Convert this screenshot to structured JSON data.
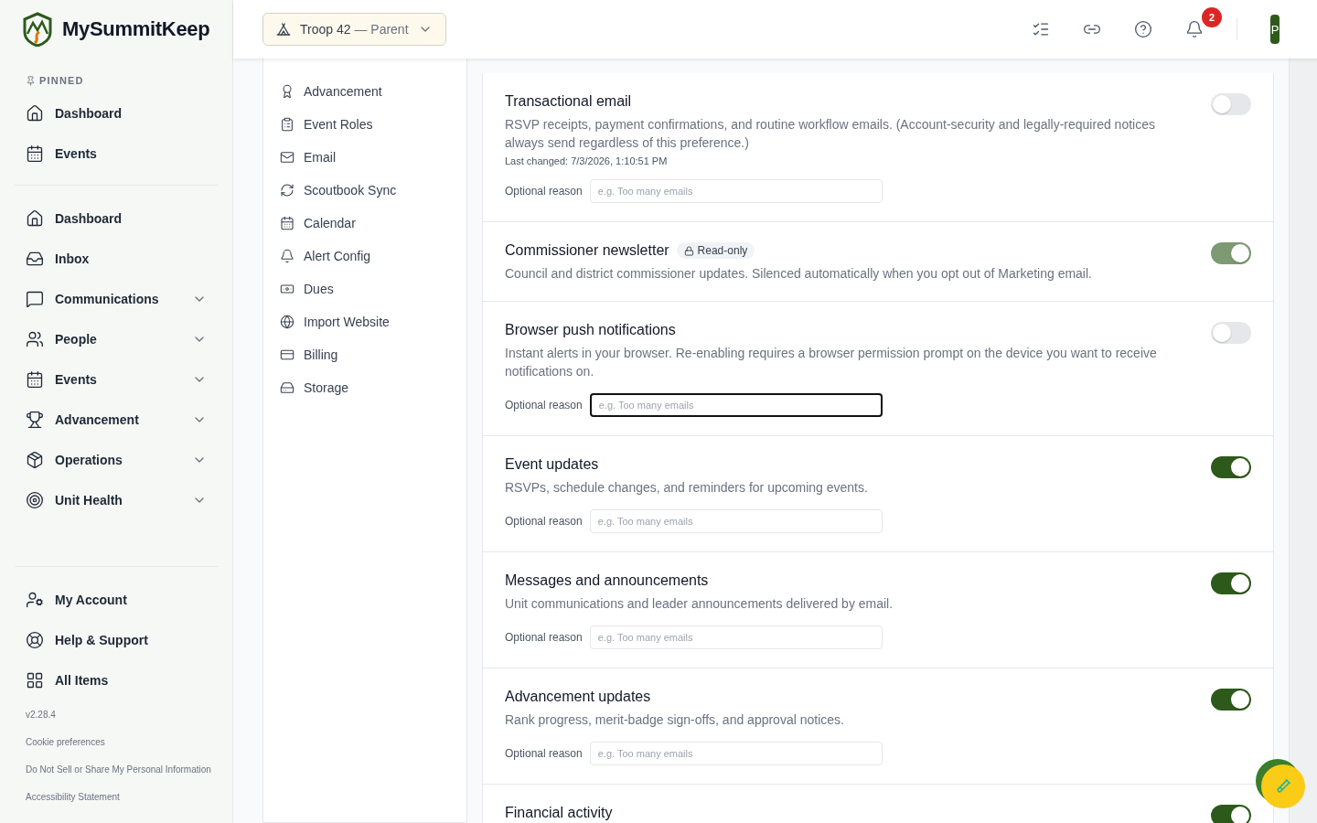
{
  "brand": {
    "name": "MySummitKeep"
  },
  "sidebar": {
    "pinned_label": "PINNED",
    "pinned": [
      {
        "label": "Dashboard"
      },
      {
        "label": "Events"
      }
    ],
    "items": [
      {
        "label": "Dashboard",
        "expandable": false
      },
      {
        "label": "Inbox",
        "expandable": false
      },
      {
        "label": "Communications",
        "expandable": true
      },
      {
        "label": "People",
        "expandable": true
      },
      {
        "label": "Events",
        "expandable": true
      },
      {
        "label": "Advancement",
        "expandable": true
      },
      {
        "label": "Operations",
        "expandable": true
      },
      {
        "label": "Unit Health",
        "expandable": true
      }
    ],
    "bottom_items": [
      {
        "label": "My Account"
      },
      {
        "label": "Help & Support"
      },
      {
        "label": "All Items"
      }
    ],
    "version": "v2.28.4",
    "footer_links": [
      "Cookie preferences",
      "Do Not Sell or Share My Personal Information",
      "Accessibility Statement"
    ]
  },
  "header": {
    "unit_selector": {
      "label": "Troop 42",
      "role": "— Parent"
    },
    "notification_count": "2",
    "avatar": "P"
  },
  "settings_nav": {
    "items": [
      {
        "label": "Advancement"
      },
      {
        "label": "Event Roles"
      },
      {
        "label": "Email"
      },
      {
        "label": "Scoutbook Sync"
      },
      {
        "label": "Calendar"
      },
      {
        "label": "Alert Config"
      },
      {
        "label": "Dues"
      },
      {
        "label": "Import Website"
      },
      {
        "label": "Billing"
      },
      {
        "label": "Storage"
      }
    ]
  },
  "preferences": [
    {
      "title": "Transactional email",
      "description": "RSVP receipts, payment confirmations, and routine workflow emails. (Account-security and legally-required notices always send regardless of this preference.)",
      "last_changed": "Last changed: 7/3/2026, 1:10:51 PM",
      "on": false,
      "reason": {
        "label": "Optional reason",
        "placeholder": "e.g. Too many emails",
        "focused": false
      }
    },
    {
      "title": "Commissioner newsletter",
      "badge": "Read-only",
      "description": "Council and district commissioner updates. Silenced automatically when you opt out of Marketing email.",
      "on": true
    },
    {
      "title": "Browser push notifications",
      "description": "Instant alerts in your browser. Re-enabling requires a browser permission prompt on the device you want to receive notifications on.",
      "on": false,
      "reason": {
        "label": "Optional reason",
        "placeholder": "e.g. Too many emails",
        "focused": true
      }
    },
    {
      "title": "Event updates",
      "description": "RSVPs, schedule changes, and reminders for upcoming events.",
      "on": true,
      "reason": {
        "label": "Optional reason",
        "placeholder": "e.g. Too many emails",
        "focused": false
      }
    },
    {
      "title": "Messages and announcements",
      "description": "Unit communications and leader announcements delivered by email.",
      "on": true,
      "reason": {
        "label": "Optional reason",
        "placeholder": "e.g. Too many emails",
        "focused": false
      }
    },
    {
      "title": "Advancement updates",
      "description": "Rank progress, merit-badge sign-offs, and approval notices.",
      "on": true,
      "reason": {
        "label": "Optional reason",
        "placeholder": "e.g. Too many emails",
        "focused": false
      }
    },
    {
      "title": "Financial activity",
      "on": true
    }
  ]
}
